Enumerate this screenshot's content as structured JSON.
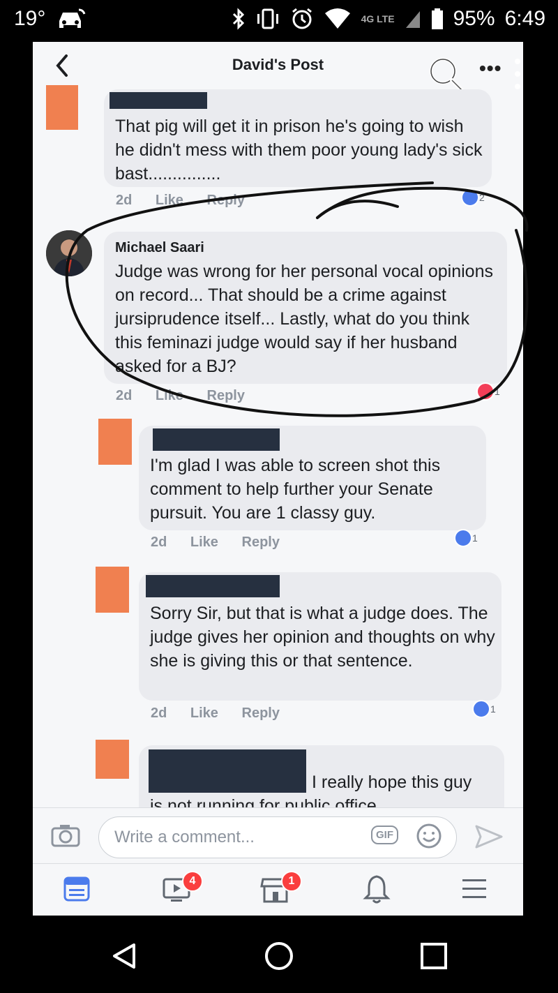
{
  "status_bar": {
    "temperature": "19°",
    "network": "4G LTE",
    "battery": "95%",
    "time": "6:49"
  },
  "header": {
    "title": "David's Post",
    "more_label": "•••"
  },
  "comments": [
    {
      "author": "",
      "text": "That pig will get it in prison he's going to wish he didn't mess with them poor young lady's sick bast...............",
      "time": "2d",
      "like": "Like",
      "reply": "Reply",
      "reaction_count": "2"
    },
    {
      "author": "Michael Saari",
      "text": "Judge was wrong for her personal vocal opinions on record... That should be a crime against jursiprudence itself... Lastly, what do you think this feminazi judge would say if her husband asked for a BJ?",
      "time": "2d",
      "like": "Like",
      "reply": "Reply",
      "reaction_count": "1"
    },
    {
      "author": "",
      "text": "I'm glad I was able to screen shot this comment to help further your Senate pursuit. You are 1 classy guy.",
      "time": "2d",
      "like": "Like",
      "reply": "Reply",
      "reaction_count": "1"
    },
    {
      "author": "",
      "text": "Sorry Sir, but that is what a judge does. The judge gives her opinion and thoughts on why she is giving this or that sentence.",
      "time": "2d",
      "like": "Like",
      "reply": "Reply",
      "reaction_count": "1"
    },
    {
      "author": "",
      "text_line1": "I really hope this guy",
      "text_line2": "is not running for public office"
    }
  ],
  "composer": {
    "placeholder": "Write a comment...",
    "gif_label": "GIF"
  },
  "nav": {
    "video_badge": "4",
    "marketplace_badge": "1"
  },
  "colors": {
    "like_blue": "#4b7bec",
    "heart_red": "#f33e58",
    "redaction": "#263040",
    "placeholder_avatar": "#f08050"
  }
}
